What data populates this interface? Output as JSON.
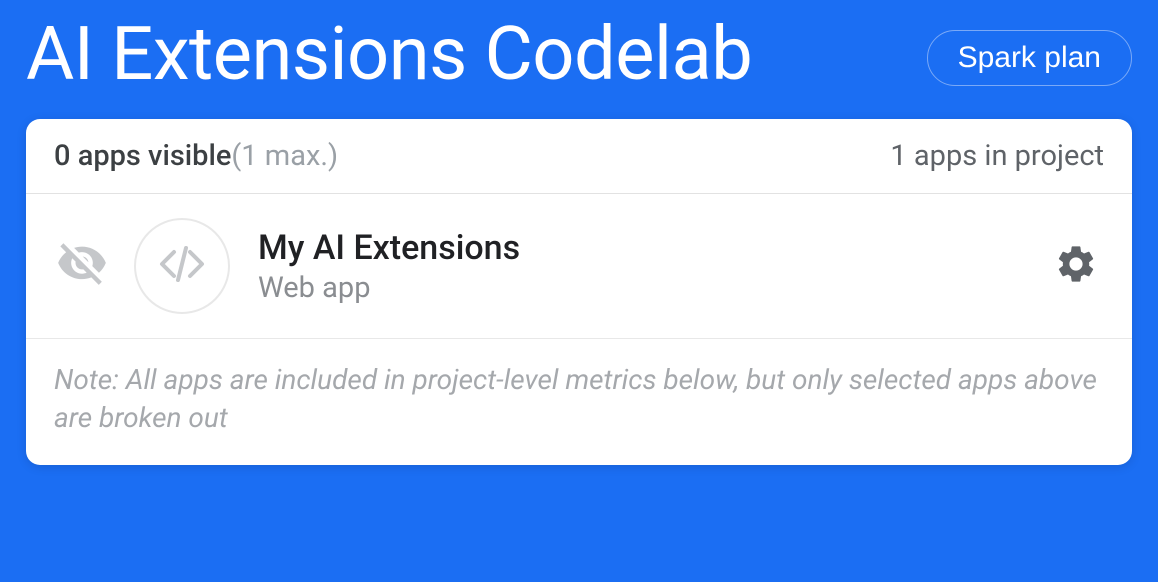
{
  "colors": {
    "background": "#1b6ef3",
    "card_bg": "#ffffff",
    "title_text": "#ffffff",
    "muted": "#9aa0a6",
    "heading": "#3c4043",
    "body": "#5f6368",
    "app_name": "#202124",
    "icon_muted": "#c5c7ca"
  },
  "header": {
    "project_title": "AI Extensions Codelab",
    "plan_label": "Spark plan"
  },
  "apps_card": {
    "visible_count_label": "0 apps visible",
    "visible_max_label": "(1 max.)",
    "apps_in_project_label": "1 apps in project",
    "apps": [
      {
        "name": "My AI Extensions",
        "platform_label": "Web app",
        "platform_icon": "code-icon",
        "visible": false
      }
    ],
    "note": "Note: All apps are included in project-level metrics below, but only selected apps above are broken out"
  }
}
